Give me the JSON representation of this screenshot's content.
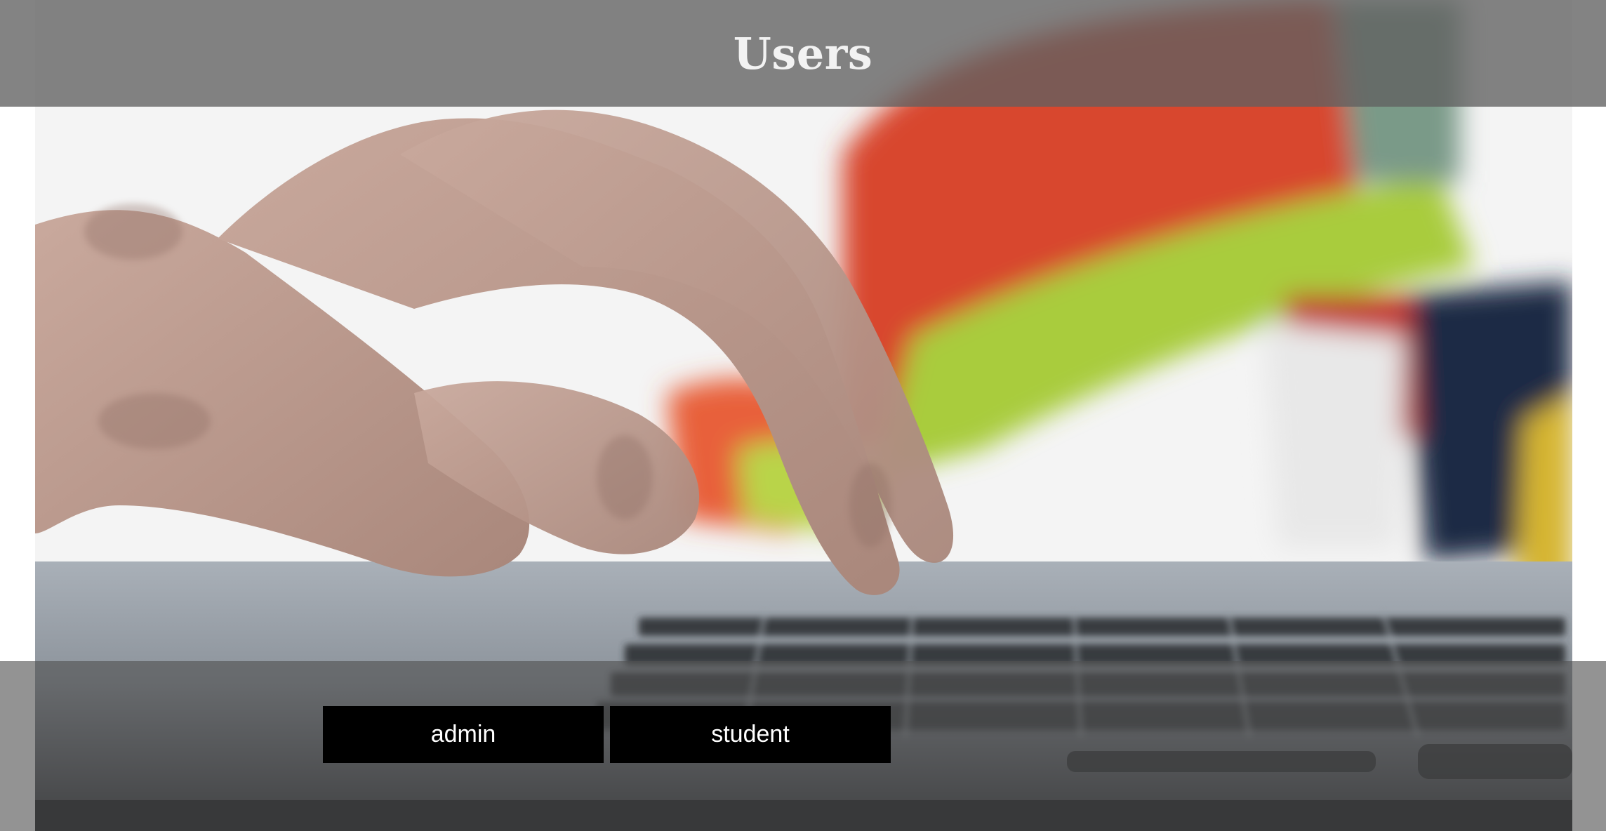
{
  "header": {
    "title": "Users"
  },
  "background": {
    "image": "hands-typing-on-laptop-keyboard"
  },
  "roles": {
    "admin_label": "admin",
    "student_label": "student"
  }
}
